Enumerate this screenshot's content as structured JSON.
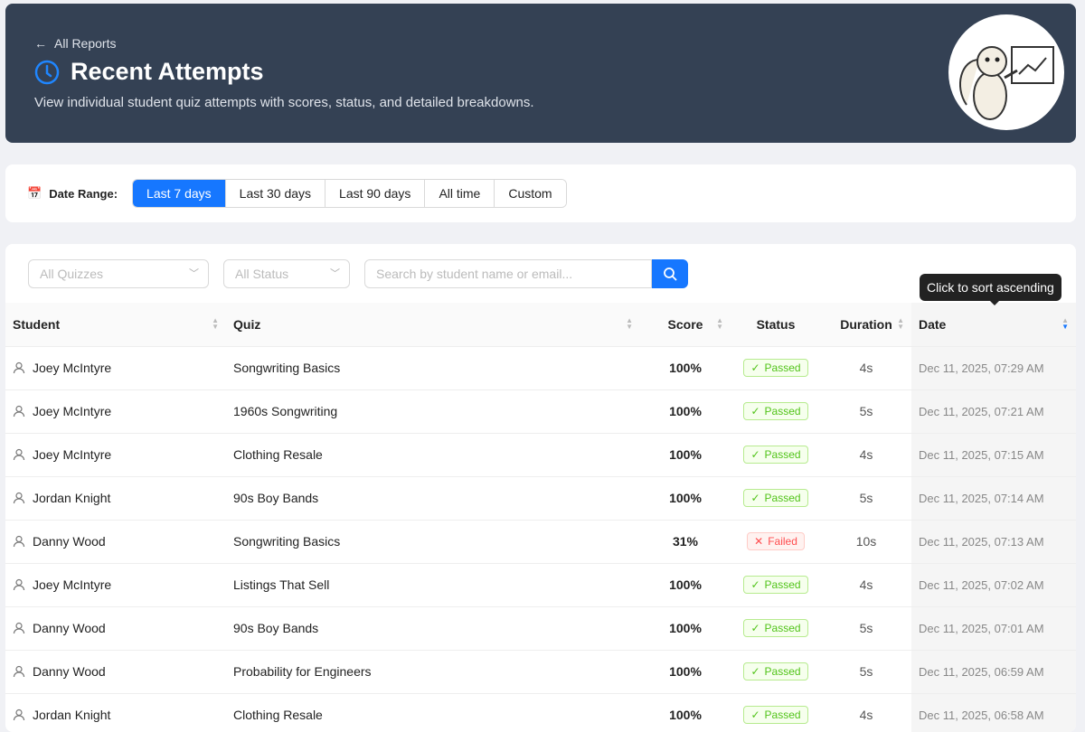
{
  "header": {
    "back_label": "All Reports",
    "title": "Recent Attempts",
    "subtitle": "View individual student quiz attempts with scores, status, and detailed breakdowns."
  },
  "date_range": {
    "label": "Date Range:",
    "options": [
      "Last 7 days",
      "Last 30 days",
      "Last 90 days",
      "All time",
      "Custom"
    ],
    "selected": "Last 7 days"
  },
  "filters": {
    "quiz_select": "All Quizzes",
    "status_select": "All Status",
    "search_placeholder": "Search by student name or email..."
  },
  "tooltip": "Click to sort ascending",
  "columns": [
    "Student",
    "Quiz",
    "Score",
    "Status",
    "Duration",
    "Date"
  ],
  "rows": [
    {
      "student": "Joey McIntyre",
      "quiz": "Songwriting Basics",
      "score": "100%",
      "status": "Passed",
      "duration": "4s",
      "date": "Dec 11, 2025, 07:29 AM"
    },
    {
      "student": "Joey McIntyre",
      "quiz": "1960s Songwriting",
      "score": "100%",
      "status": "Passed",
      "duration": "5s",
      "date": "Dec 11, 2025, 07:21 AM"
    },
    {
      "student": "Joey McIntyre",
      "quiz": "Clothing Resale",
      "score": "100%",
      "status": "Passed",
      "duration": "4s",
      "date": "Dec 11, 2025, 07:15 AM"
    },
    {
      "student": "Jordan Knight",
      "quiz": "90s Boy Bands",
      "score": "100%",
      "status": "Passed",
      "duration": "5s",
      "date": "Dec 11, 2025, 07:14 AM"
    },
    {
      "student": "Danny Wood",
      "quiz": "Songwriting Basics",
      "score": "31%",
      "status": "Failed",
      "duration": "10s",
      "date": "Dec 11, 2025, 07:13 AM"
    },
    {
      "student": "Joey McIntyre",
      "quiz": "Listings That Sell",
      "score": "100%",
      "status": "Passed",
      "duration": "4s",
      "date": "Dec 11, 2025, 07:02 AM"
    },
    {
      "student": "Danny Wood",
      "quiz": "90s Boy Bands",
      "score": "100%",
      "status": "Passed",
      "duration": "5s",
      "date": "Dec 11, 2025, 07:01 AM"
    },
    {
      "student": "Danny Wood",
      "quiz": "Probability for Engineers",
      "score": "100%",
      "status": "Passed",
      "duration": "5s",
      "date": "Dec 11, 2025, 06:59 AM"
    },
    {
      "student": "Jordan Knight",
      "quiz": "Clothing Resale",
      "score": "100%",
      "status": "Passed",
      "duration": "4s",
      "date": "Dec 11, 2025, 06:58 AM"
    }
  ]
}
